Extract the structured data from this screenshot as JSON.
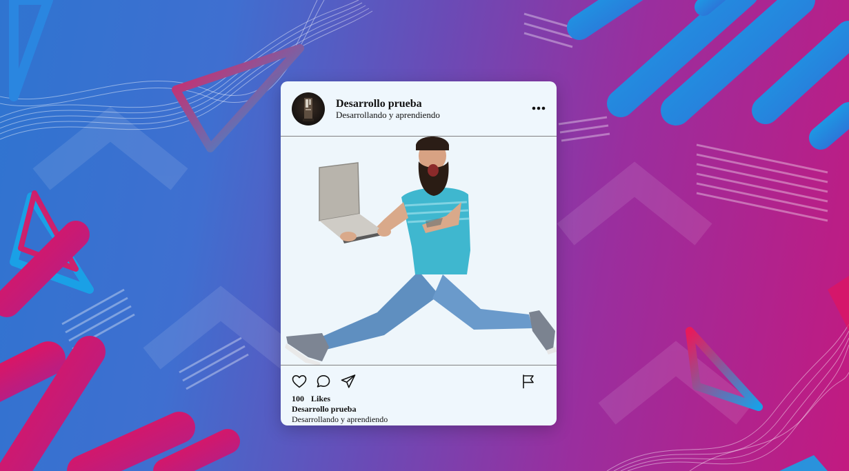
{
  "post": {
    "user_name": "Desarrollo prueba",
    "user_subtitle": "Desarrollando y aprendiendo",
    "likes_count": "100",
    "likes_label": "Likes",
    "caption_user": "Desarrollo prueba",
    "caption_text": "Desarrollando y aprendiendo"
  },
  "icons": {
    "more": "more-options-icon",
    "like": "heart-icon",
    "comment": "comment-bubble-icon",
    "share": "send-icon",
    "report": "flag-icon"
  },
  "colors": {
    "card_background": "#eff7fd",
    "bg_blue": "#2f74d0",
    "bg_purple": "#6a4bb6",
    "bg_magenta": "#c21a80",
    "accent_cyan": "#1aa0e6",
    "accent_pink": "#e0145f"
  }
}
